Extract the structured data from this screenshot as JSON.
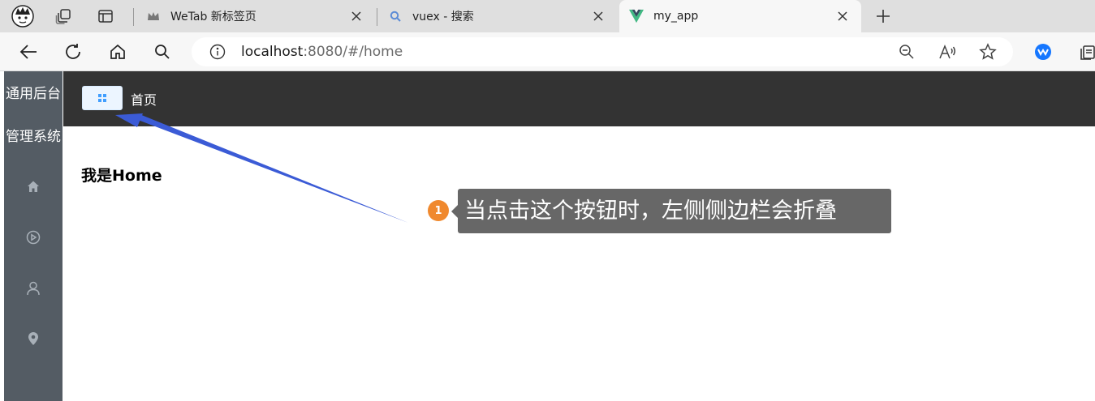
{
  "browser": {
    "tabs": [
      {
        "title": "WeTab 新标签页",
        "icon": "wetab-crown-icon",
        "active": false
      },
      {
        "title": "vuex - 搜索",
        "icon": "search-icon",
        "active": false
      },
      {
        "title": "my_app",
        "icon": "vue-logo-icon",
        "active": true
      }
    ],
    "url_host": "localhost",
    "url_rest": ":8080/#/home"
  },
  "app": {
    "brand_line1": "通用后台",
    "brand_line2": "管理系统",
    "menu_icons": [
      "home-icon",
      "video-play-icon",
      "user-icon",
      "location-icon"
    ],
    "breadcrumb": "首页",
    "main_title": "我是Home"
  },
  "annotation": {
    "badge": "1",
    "text": "当点击这个按钮时，左侧侧边栏会折叠"
  },
  "colors": {
    "sidebar": "#545c64",
    "header": "#333333",
    "annotation_bg": "#676767",
    "badge": "#f0892e",
    "arrow": "#3b5bd6"
  }
}
